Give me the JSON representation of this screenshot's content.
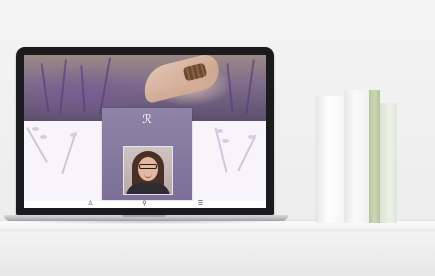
{
  "scene": {
    "description_hidden": false
  },
  "website": {
    "logo_glyph": "ℛ",
    "subtitle": "",
    "name": "",
    "nav_icons": [
      {
        "name": "person-icon",
        "glyph": "♙"
      },
      {
        "name": "location-pin-icon",
        "glyph": "⚲"
      },
      {
        "name": "menu-list-icon",
        "glyph": "☰"
      }
    ]
  },
  "colors": {
    "card_purple": "#7c7098",
    "lavender": "#5c4f6e",
    "book_green": "#b6c59f"
  }
}
